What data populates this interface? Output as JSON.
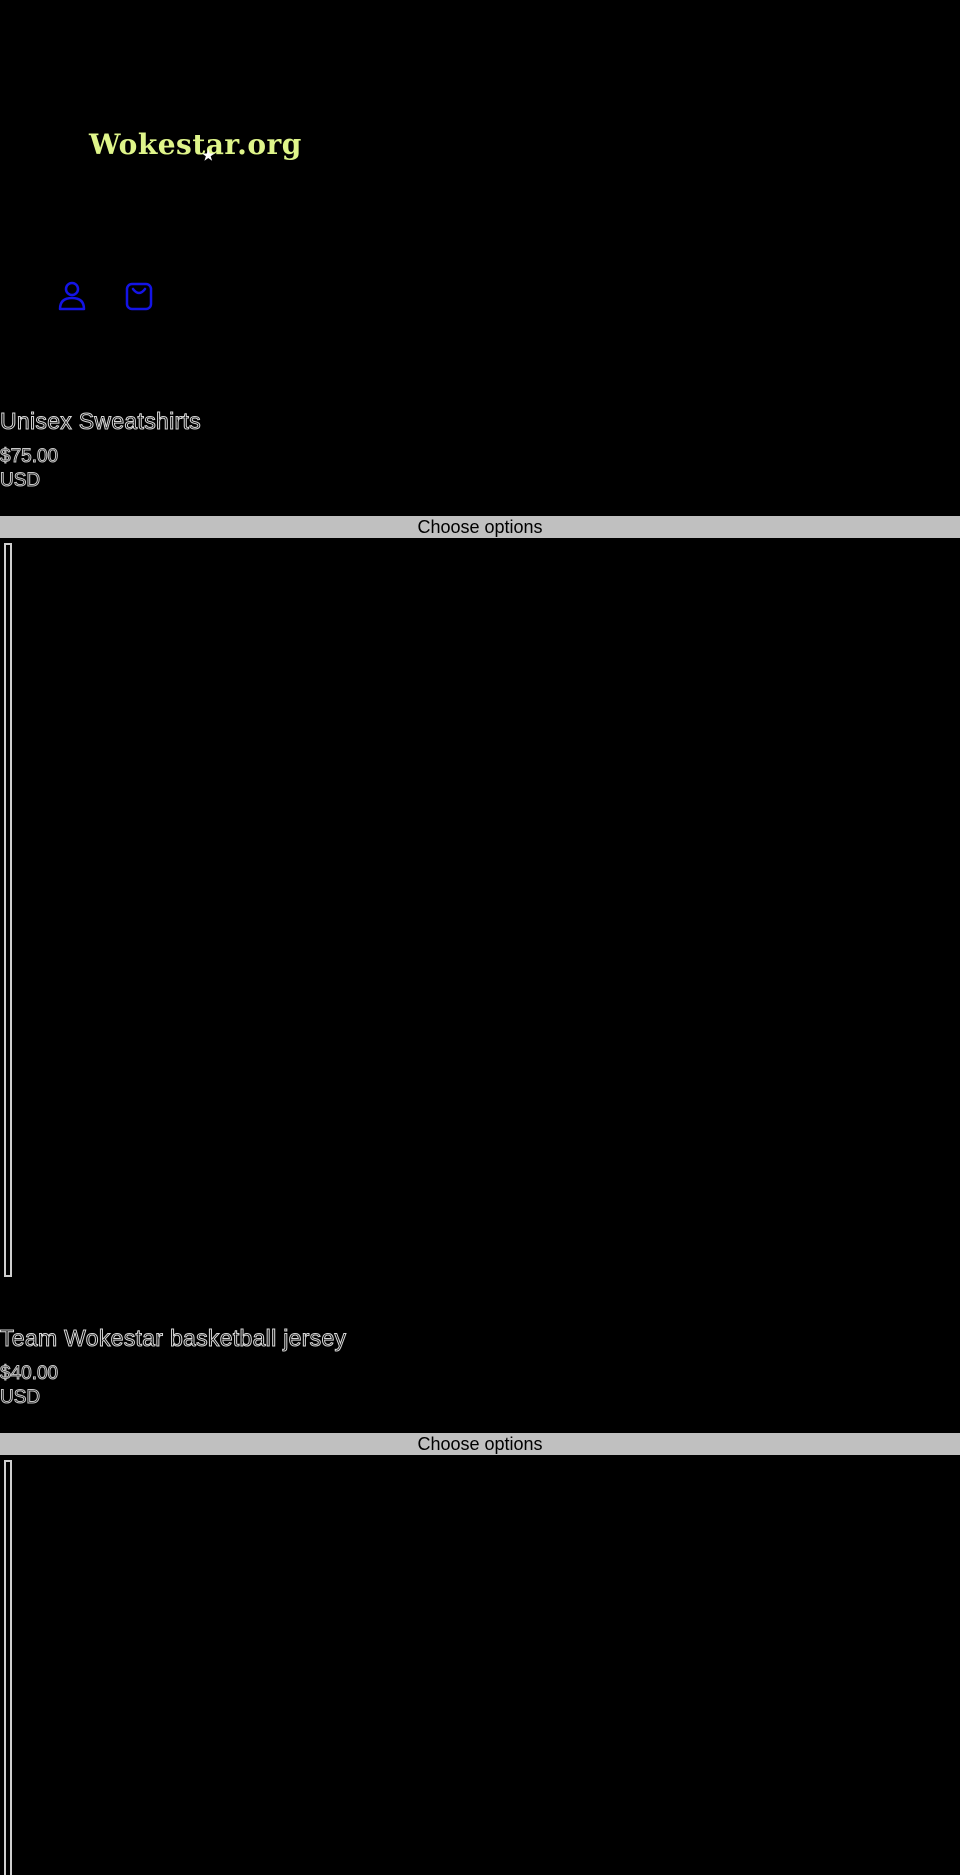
{
  "site": {
    "logo_text": "Wokestar.org",
    "logo_color": "#dff58a",
    "icon_color": "#1414e6"
  },
  "header": {
    "icons": [
      {
        "name": "account-icon"
      },
      {
        "name": "cart-icon"
      }
    ]
  },
  "products": [
    {
      "title": "Unisex Sweatshirts",
      "price": "$75.00",
      "currency": "USD",
      "button_label": "Choose options"
    },
    {
      "title": "Team Wokestar basketball jersey",
      "price": "$40.00",
      "currency": "USD",
      "button_label": "Choose options"
    }
  ]
}
